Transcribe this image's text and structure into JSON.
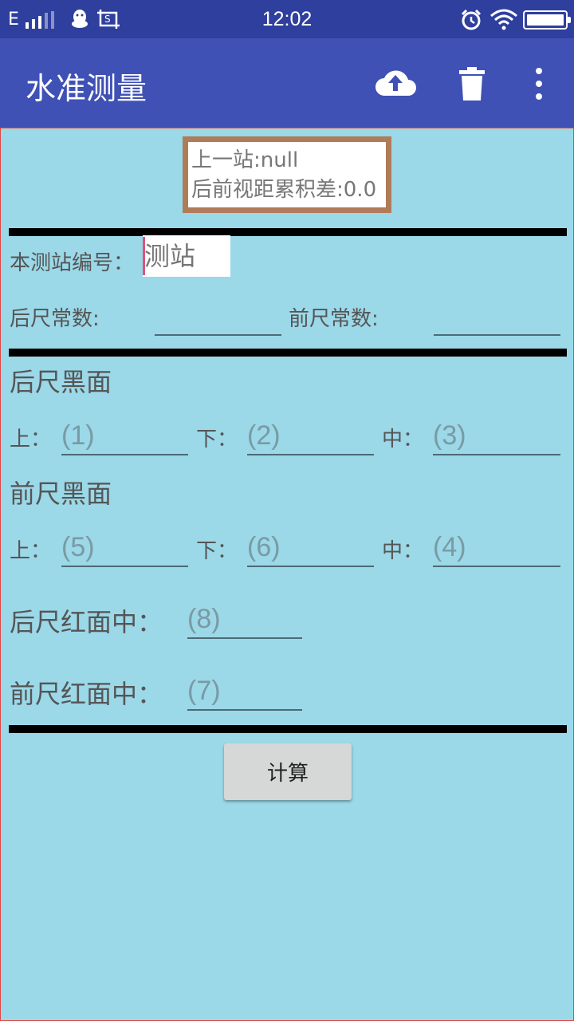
{
  "status_bar": {
    "network": "E",
    "time": "12:02",
    "icons": [
      "signal-icon",
      "qq-icon",
      "screenshot-icon",
      "alarm-icon",
      "wifi-icon",
      "battery-icon"
    ]
  },
  "app_bar": {
    "title": "水准测量",
    "icons": [
      "upload-cloud-icon",
      "trash-icon",
      "more-vert-icon"
    ]
  },
  "info": {
    "previous_station": "上一站:null",
    "distance_diff": "后前视距累积差:0.0"
  },
  "station": {
    "label": "本测站编号：",
    "placeholder": "测站"
  },
  "constants": {
    "back_label": "后尺常数:",
    "front_label": "前尺常数:"
  },
  "back_black": {
    "heading": "后尺黑面",
    "upper_label": "上：",
    "upper_placeholder": "(1)",
    "lower_label": "下：",
    "lower_placeholder": "(2)",
    "middle_label": "中：",
    "middle_placeholder": "(3)"
  },
  "front_black": {
    "heading": "前尺黑面",
    "upper_label": "上：",
    "upper_placeholder": "(5)",
    "lower_label": "下：",
    "lower_placeholder": "(6)",
    "middle_label": "中：",
    "middle_placeholder": "(4)"
  },
  "red": {
    "back_label": "后尺红面中：",
    "back_placeholder": "(8)",
    "front_label": "前尺红面中：",
    "front_placeholder": "(7)"
  },
  "actions": {
    "calculate_label": "计算"
  },
  "colors": {
    "app_bar": "#3f51b5",
    "status_bar": "#2f3f9e",
    "background": "#9bd8e8",
    "info_border": "#b07b58"
  }
}
